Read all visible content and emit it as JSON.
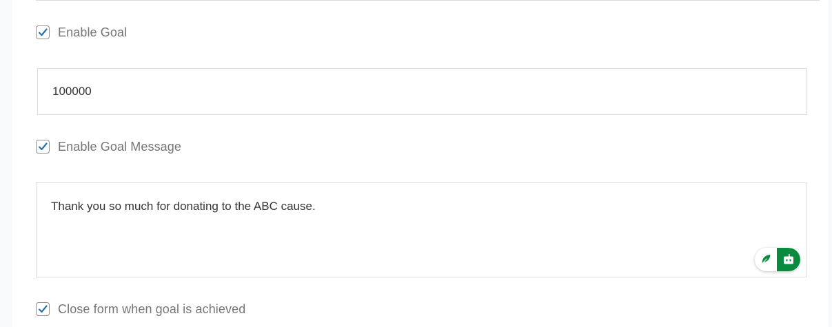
{
  "form": {
    "enable_goal": {
      "label": "Enable Goal",
      "checked": true
    },
    "goal_amount": {
      "value": "100000"
    },
    "enable_goal_message": {
      "label": "Enable Goal Message",
      "checked": true
    },
    "goal_message": {
      "value": "Thank you so much for donating to the ABC cause."
    },
    "close_form": {
      "label": "Close form when goal is achieved",
      "checked": true
    }
  },
  "writing_assistant": {
    "leaf_icon": "leaf-icon",
    "bot_icon": "robot-icon",
    "accent_color": "#0a8a3e"
  },
  "colors": {
    "checkbox_check": "#2271b1",
    "label_text": "#757575",
    "input_border": "#dcdcde"
  }
}
